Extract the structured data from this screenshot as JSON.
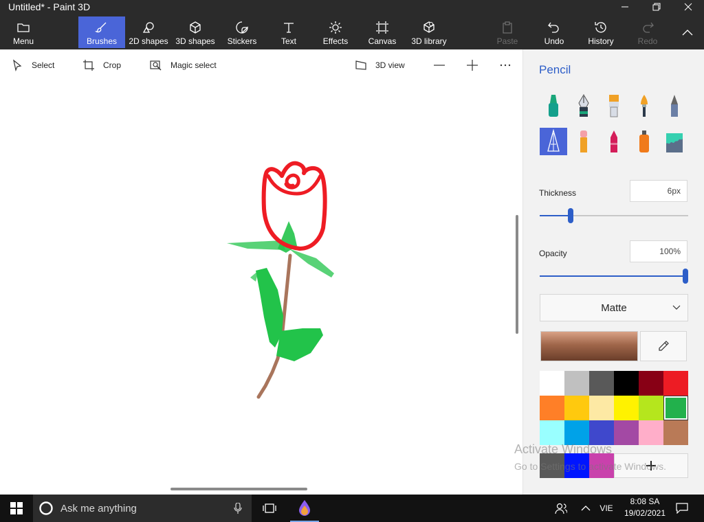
{
  "window": {
    "title": "Untitled* - Paint 3D"
  },
  "ribbon": {
    "items": [
      {
        "label": "Menu",
        "icon": "folder-icon"
      },
      {
        "label": "Brushes",
        "icon": "brush-icon",
        "active": true
      },
      {
        "label": "2D shapes",
        "icon": "shapes-2d-icon"
      },
      {
        "label": "3D shapes",
        "icon": "cube-icon"
      },
      {
        "label": "Stickers",
        "icon": "sticker-icon"
      },
      {
        "label": "Text",
        "icon": "text-icon"
      },
      {
        "label": "Effects",
        "icon": "sun-icon"
      },
      {
        "label": "Canvas",
        "icon": "canvas-icon"
      },
      {
        "label": "3D library",
        "icon": "library-icon"
      },
      {
        "label": "Paste",
        "icon": "paste-icon",
        "disabled": true
      },
      {
        "label": "Undo",
        "icon": "undo-icon"
      },
      {
        "label": "History",
        "icon": "history-icon"
      },
      {
        "label": "Redo",
        "icon": "redo-icon",
        "disabled": true
      }
    ]
  },
  "toolbar": {
    "select_label": "Select",
    "crop_label": "Crop",
    "magic_select_label": "Magic select",
    "view_3d_label": "3D view"
  },
  "panel": {
    "title": "Pencil",
    "tools": [
      "marker-icon",
      "calligraphy-pen-icon",
      "oil-brush-icon",
      "watercolor-icon",
      "pencil-icon",
      "pixel-pen-icon",
      "eraser-icon",
      "crayon-icon",
      "spray-can-icon",
      "fill-bucket-icon"
    ],
    "selected_tool": "pixel-pen-icon",
    "thickness_label": "Thickness",
    "thickness_value": "6px",
    "thickness_level": 0.21,
    "opacity_label": "Opacity",
    "opacity_value": "100%",
    "opacity_level": 1.0,
    "finish_value": "Matte",
    "current_color": "#a0664a",
    "palette": [
      "#ffffff",
      "#c0c0c0",
      "#595959",
      "#000000",
      "#880015",
      "#ed1c24",
      "#ff7f27",
      "#ffc90e",
      "#fde9a4",
      "#fff200",
      "#b5e61d",
      "#22b14c",
      "#99ffff",
      "#00a2e8",
      "#3f48cc",
      "#a349a4",
      "#ffaec9",
      "#b97a57"
    ],
    "selected_swatch": 11,
    "custom_colors": [
      "#595959",
      "#0015ff",
      "#c941ac"
    ]
  },
  "watermark": {
    "line1": "Activate Windows",
    "line2": "Go to Settings to activate Windows."
  },
  "taskbar": {
    "search_placeholder": "Ask me anything",
    "language": "VIE",
    "time": "8:08 SA",
    "date": "19/02/2021"
  },
  "colors": {
    "accent": "#4a65d8",
    "panel_accent": "#2d5ec8",
    "chrome": "#2b2b2b"
  }
}
